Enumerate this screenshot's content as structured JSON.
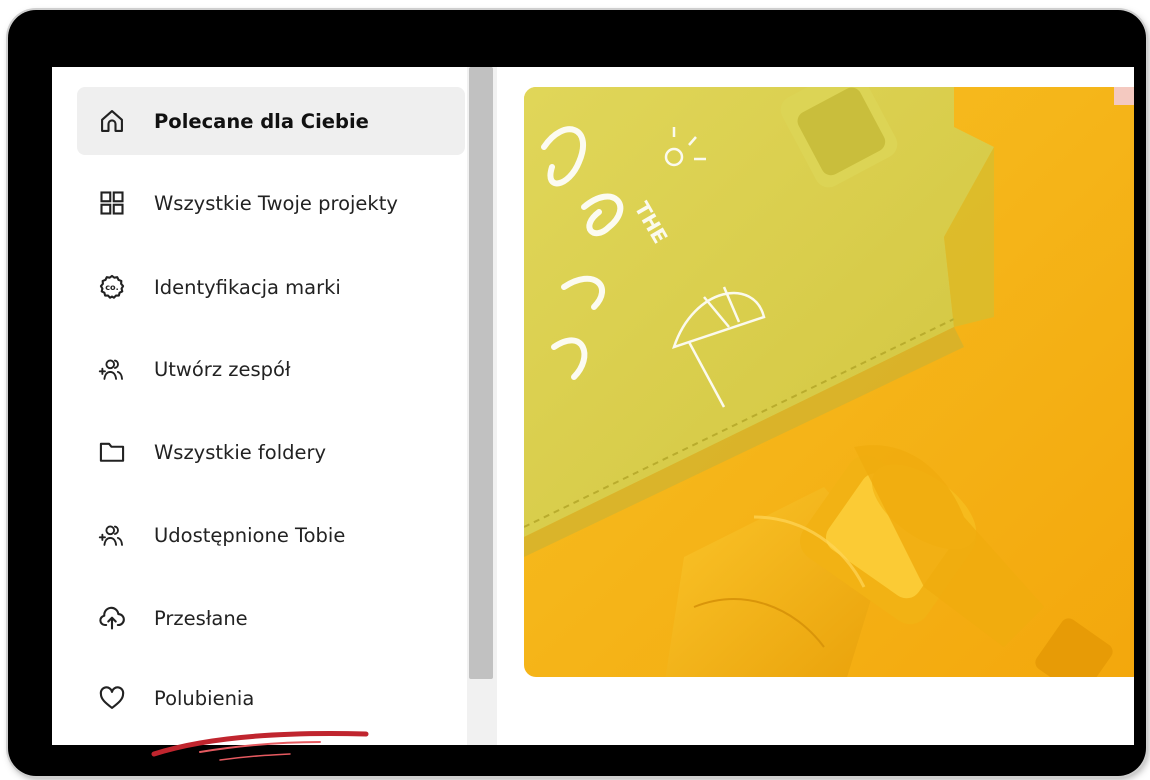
{
  "sidebar": {
    "items": [
      {
        "label": "Polecane dla Ciebie",
        "icon": "home-icon",
        "active": true
      },
      {
        "label": "Wszystkie Twoje projekty",
        "icon": "grid-icon",
        "active": false
      },
      {
        "label": "Identyfikacja marki",
        "icon": "brand-kit-icon",
        "active": false
      },
      {
        "label": "Utwórz zespół",
        "icon": "add-team-icon",
        "active": false
      },
      {
        "label": "Wszystkie foldery",
        "icon": "folder-icon",
        "active": false
      },
      {
        "label": "Udostępnione Tobie",
        "icon": "shared-icon",
        "active": false
      },
      {
        "label": "Przesłane",
        "icon": "upload-icon",
        "active": false
      },
      {
        "label": "Polubienia",
        "icon": "heart-icon",
        "active": false
      }
    ]
  },
  "hero": {
    "image": "yellow-notebook-and-binoculars-photo",
    "printed_text": "THE Sea Season"
  },
  "colors": {
    "active_bg": "#efefef",
    "device_frame": "#000000",
    "hero_orange": "#f5b316",
    "notebook_yellow": "#dcd14f",
    "swoosh_red": "#c0252e"
  }
}
